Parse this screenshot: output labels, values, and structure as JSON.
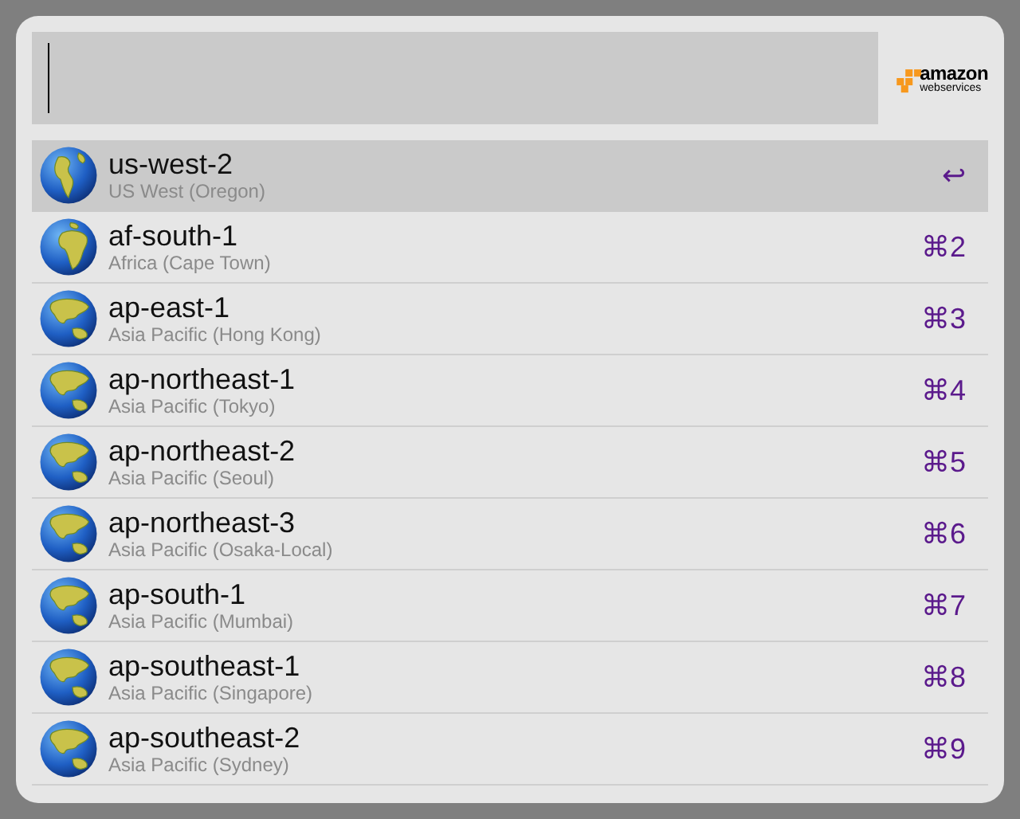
{
  "logo": {
    "line_1": "amazon",
    "line_2": "webservices"
  },
  "results": [
    {
      "title": "us-west-2",
      "subtitle": "US West (Oregon)",
      "shortcut": "↩",
      "kind": "americas",
      "selected": true
    },
    {
      "title": "af-south-1",
      "subtitle": "Africa (Cape Town)",
      "shortcut": "⌘2",
      "kind": "africa",
      "selected": false
    },
    {
      "title": "ap-east-1",
      "subtitle": "Asia Pacific (Hong Kong)",
      "shortcut": "⌘3",
      "kind": "asia",
      "selected": false
    },
    {
      "title": "ap-northeast-1",
      "subtitle": "Asia Pacific (Tokyo)",
      "shortcut": "⌘4",
      "kind": "asia",
      "selected": false
    },
    {
      "title": "ap-northeast-2",
      "subtitle": "Asia Pacific (Seoul)",
      "shortcut": "⌘5",
      "kind": "asia",
      "selected": false
    },
    {
      "title": "ap-northeast-3",
      "subtitle": "Asia Pacific (Osaka-Local)",
      "shortcut": "⌘6",
      "kind": "asia",
      "selected": false
    },
    {
      "title": "ap-south-1",
      "subtitle": "Asia Pacific (Mumbai)",
      "shortcut": "⌘7",
      "kind": "asia",
      "selected": false
    },
    {
      "title": "ap-southeast-1",
      "subtitle": "Asia Pacific (Singapore)",
      "shortcut": "⌘8",
      "kind": "asia",
      "selected": false
    },
    {
      "title": "ap-southeast-2",
      "subtitle": "Asia Pacific (Sydney)",
      "shortcut": "⌘9",
      "kind": "asia",
      "selected": false
    }
  ]
}
